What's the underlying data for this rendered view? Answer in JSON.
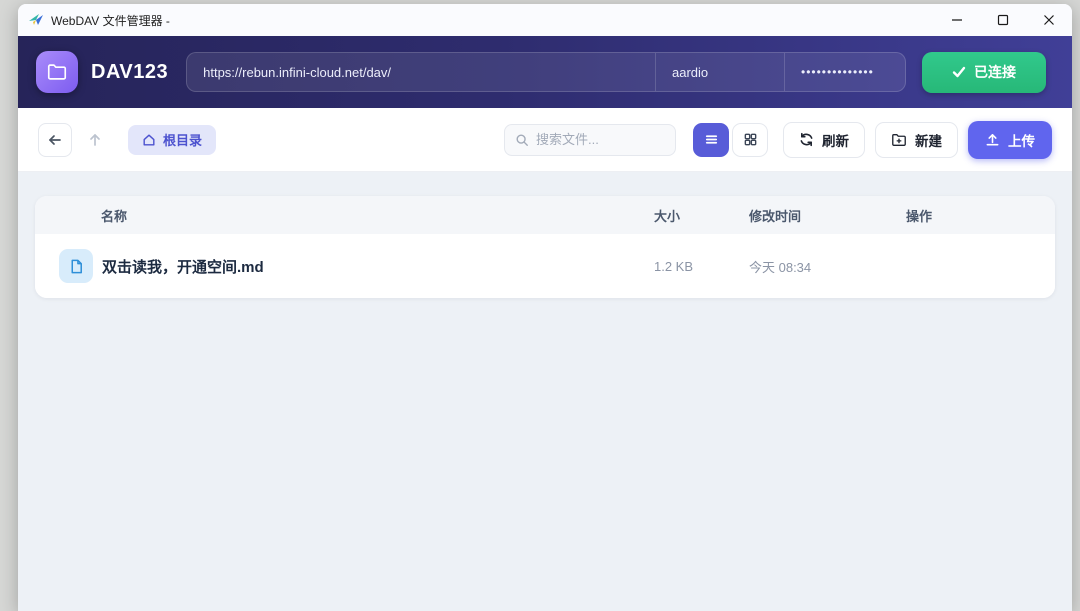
{
  "window": {
    "title": "WebDAV 文件管理器 -"
  },
  "header": {
    "app_name": "DAV123",
    "url_value": "https://rebun.infini-cloud.net/dav/",
    "username_value": "aardio",
    "password_value": "••••••••••••••",
    "connect_label": "已连接",
    "colors": {
      "header_gradient_start": "#262459",
      "header_gradient_end": "#403f97",
      "logo_gradient_start": "#a98cfa",
      "logo_gradient_end": "#7d5cf0",
      "connect_green": "#2bbf81",
      "accent_indigo": "#6065ee"
    }
  },
  "toolbar": {
    "breadcrumb_label": "根目录",
    "search_placeholder": "搜索文件...",
    "refresh_label": "刷新",
    "new_label": "新建",
    "upload_label": "上传"
  },
  "file_table": {
    "columns": [
      "名称",
      "大小",
      "修改时间",
      "操作"
    ],
    "rows": [
      {
        "name": "双击读我，开通空间.md",
        "size": "1.2 KB",
        "modified": "今天 08:34"
      }
    ]
  }
}
